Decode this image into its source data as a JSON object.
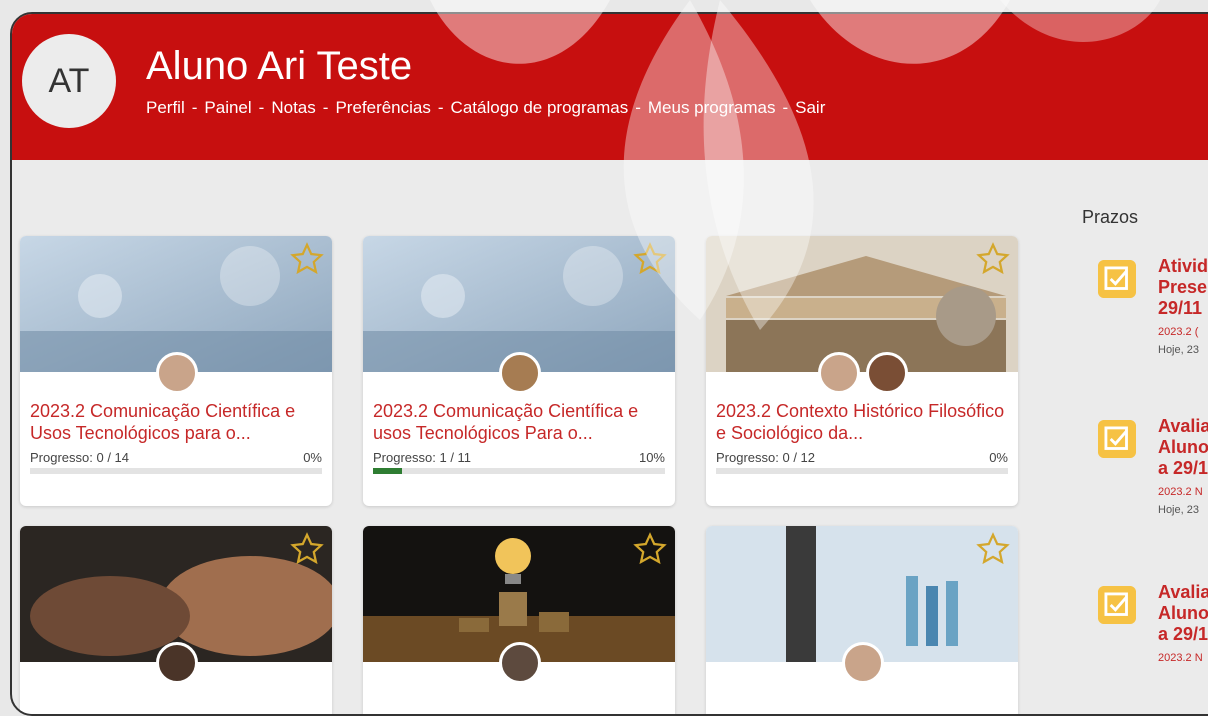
{
  "user": {
    "initials": "AT",
    "name": "Aluno Ari Teste"
  },
  "nav": {
    "perfil": "Perfil",
    "painel": "Painel",
    "notas": "Notas",
    "preferencias": "Preferências",
    "catalogo": "Catálogo de programas",
    "meus": "Meus programas",
    "sair": "Sair",
    "separator": "-"
  },
  "courses": [
    {
      "title": "2023.2 Comunicação Científica e Usos Tecnológicos para o...",
      "progress_label": "Progresso: 0 / 14",
      "percent_label": "0%",
      "percent": 0
    },
    {
      "title": "2023.2 Comunicação Científica e usos Tecnológicos Para o...",
      "progress_label": "Progresso: 1 / 11",
      "percent_label": "10%",
      "percent": 10
    },
    {
      "title": "2023.2 Contexto Histórico Filosófico e Sociológico da...",
      "progress_label": "Progresso: 0 / 12",
      "percent_label": "0%",
      "percent": 0
    },
    {
      "title": "",
      "progress_label": "",
      "percent_label": ""
    },
    {
      "title": "",
      "progress_label": "",
      "percent_label": ""
    },
    {
      "title": "",
      "progress_label": "",
      "percent_label": ""
    }
  ],
  "prazos": {
    "title": "Prazos",
    "items": [
      {
        "line1": "Ativida",
        "line2": "Presen",
        "line3": "29/11",
        "course": "2023.2 (",
        "date": "Hoje, 23"
      },
      {
        "line1": "Avalia",
        "line2": "Alunos",
        "line3": "a 29/1",
        "course": "2023.2 N",
        "date": "Hoje, 23"
      },
      {
        "line1": "Avalia",
        "line2": "Alunos",
        "line3": "a 29/1",
        "course": "2023.2 N",
        "date": ""
      }
    ]
  },
  "colors": {
    "brand": "#c70f0f",
    "link": "#c62828",
    "task_icon": "#f6c244",
    "progress": "#2e7d32"
  },
  "icons": {
    "favorite": "star-icon",
    "task": "checkbox-task-icon"
  }
}
